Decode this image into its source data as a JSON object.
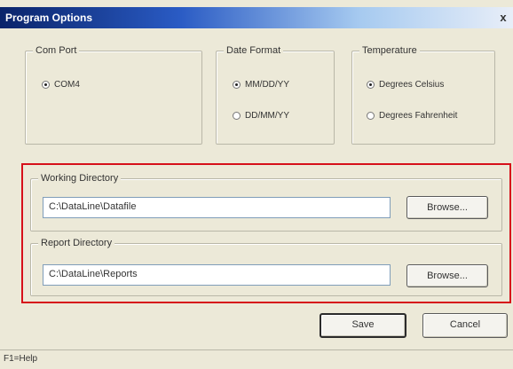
{
  "window": {
    "title": "Program Options",
    "close_glyph": "x"
  },
  "com_port": {
    "legend": "Com Port",
    "options": [
      "COM4"
    ],
    "selected": 0
  },
  "date_format": {
    "legend": "Date Format",
    "options": [
      "MM/DD/YY",
      "DD/MM/YY"
    ],
    "selected": 0
  },
  "temperature": {
    "legend": "Temperature",
    "options": [
      "Degrees Celsius",
      "Degrees Fahrenheit"
    ],
    "selected": 0
  },
  "working_directory": {
    "legend": "Working Directory",
    "value": "C:\\DataLine\\Datafile",
    "browse_label": "Browse..."
  },
  "report_directory": {
    "legend": "Report Directory",
    "value": "C:\\DataLine\\Reports",
    "browse_label": "Browse..."
  },
  "buttons": {
    "save": "Save",
    "cancel": "Cancel"
  },
  "statusbar": {
    "text": "F1=Help"
  },
  "colors": {
    "highlight_frame": "#d6101a",
    "titlebar": "#0a246a"
  }
}
